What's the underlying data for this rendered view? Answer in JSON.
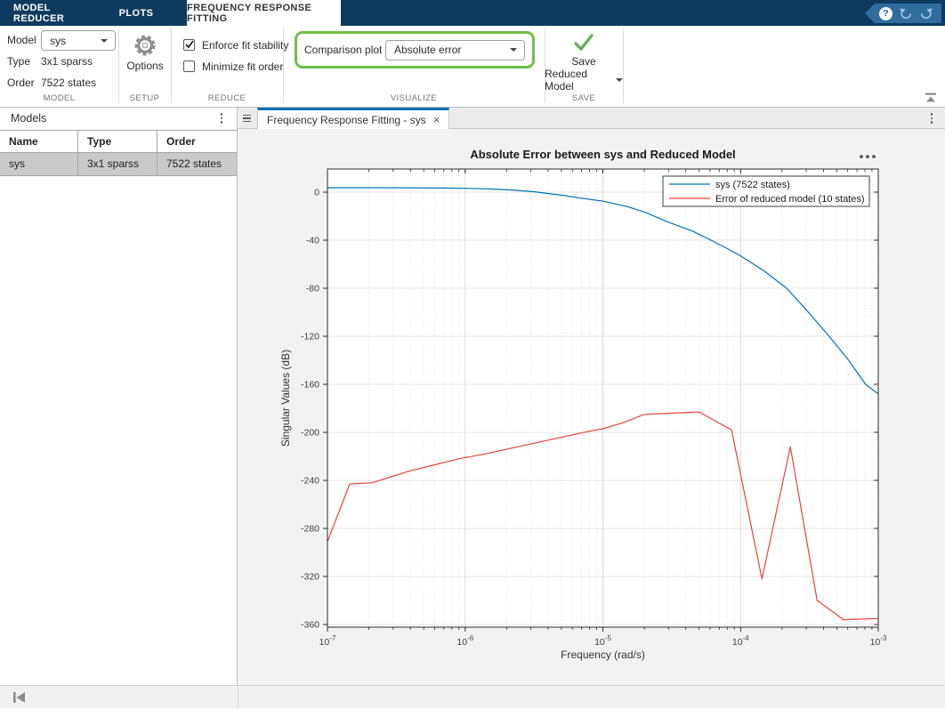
{
  "ribbon_tabs": [
    {
      "label": "MODEL REDUCER"
    },
    {
      "label": "PLOTS"
    },
    {
      "label": "FREQUENCY RESPONSE FITTING",
      "active": true
    }
  ],
  "quick_access": {
    "help_glyph": "?"
  },
  "toolbar": {
    "model_section": {
      "label": "MODEL",
      "model_label": "Model",
      "model_value": "sys",
      "type_label": "Type",
      "type_value": "3x1 sparss",
      "order_label": "Order",
      "order_value": "7522 states"
    },
    "setup_section": {
      "label": "SETUP",
      "options_label": "Options"
    },
    "reduce_section": {
      "label": "REDUCE",
      "checkbox_stability": {
        "label": "Enforce fit stability",
        "checked": true
      },
      "checkbox_order": {
        "label": "Minimize fit order",
        "checked": false
      }
    },
    "visualize_section": {
      "label": "VISUALIZE",
      "comparison_label": "Comparison plot",
      "comparison_value": "Absolute error",
      "highlight_color": "#6fbf45"
    },
    "save_section": {
      "label": "SAVE",
      "save_line1": "Save",
      "save_line2": "Reduced Model"
    }
  },
  "models_panel": {
    "title": "Models",
    "columns": [
      "Name",
      "Type",
      "Order"
    ],
    "rows": [
      {
        "name": "sys",
        "type": "3x1 sparss",
        "order": "7522 states",
        "selected": true
      }
    ]
  },
  "document": {
    "tab_title": "Frequency Response Fitting - sys",
    "close_glyph": "×"
  },
  "chart_data": {
    "type": "line",
    "title": "Absolute Error between sys and Reduced Model",
    "xlabel": "Frequency (rad/s)",
    "ylabel": "Singular Values (dB)",
    "xscale": "log",
    "xlim": [
      1e-07,
      0.001
    ],
    "ylim": [
      -360,
      19
    ],
    "grid": true,
    "legend_position": "top-right",
    "x_tick_exponents": [
      -7,
      -6,
      -5,
      -4,
      -3
    ],
    "y_ticks": [
      0,
      -40,
      -80,
      -120,
      -160,
      -200,
      -240,
      -280,
      -320,
      -360
    ],
    "series": [
      {
        "name": "sys (7522 states)",
        "color": "#0072BD",
        "points": [
          [
            1e-07,
            3.7
          ],
          [
            2e-07,
            3.7
          ],
          [
            4e-07,
            3.6
          ],
          [
            7e-07,
            3.4
          ],
          [
            1e-06,
            3.2
          ],
          [
            1.5e-06,
            2.7
          ],
          [
            2.2e-06,
            1.8
          ],
          [
            3.2e-06,
            0.3
          ],
          [
            5e-06,
            -2.5
          ],
          [
            7e-06,
            -5
          ],
          [
            1e-05,
            -7.5
          ],
          [
            1.5e-05,
            -12
          ],
          [
            2e-05,
            -16.5
          ],
          [
            3e-05,
            -25
          ],
          [
            4.5e-05,
            -32.5
          ],
          [
            6.1e-05,
            -40
          ],
          [
            8e-05,
            -47
          ],
          [
            0.0001,
            -53
          ],
          [
            0.00015,
            -66
          ],
          [
            0.000216,
            -80
          ],
          [
            0.0003,
            -98
          ],
          [
            0.00044,
            -120
          ],
          [
            0.0006,
            -139
          ],
          [
            0.00081,
            -160
          ],
          [
            0.001,
            -168
          ]
        ]
      },
      {
        "name": "Error of reduced model (10 states)",
        "color": "#E8433C",
        "points": [
          [
            1e-07,
            -291
          ],
          [
            1.45e-07,
            -243
          ],
          [
            2.1e-07,
            -242
          ],
          [
            2.9e-07,
            -237
          ],
          [
            4e-07,
            -232
          ],
          [
            6e-07,
            -227
          ],
          [
            9e-07,
            -222
          ],
          [
            1.4e-06,
            -218
          ],
          [
            2.2e-06,
            -213
          ],
          [
            3.5e-06,
            -208
          ],
          [
            5.5e-06,
            -203
          ],
          [
            8e-06,
            -199
          ],
          [
            1e-05,
            -197
          ],
          [
            1.4e-05,
            -192
          ],
          [
            2e-05,
            -185
          ],
          [
            3.2e-05,
            -184
          ],
          [
            5e-05,
            -183
          ],
          [
            8.6e-05,
            -198
          ],
          [
            0.000143,
            -322
          ],
          [
            0.00023,
            -212
          ],
          [
            0.00036,
            -340
          ],
          [
            0.00056,
            -356
          ],
          [
            0.001,
            -355
          ]
        ]
      }
    ]
  }
}
